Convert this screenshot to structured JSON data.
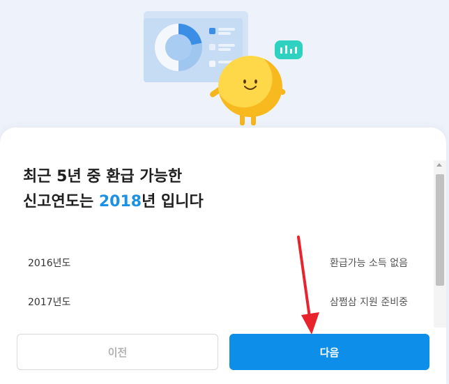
{
  "header": {
    "title_line1": "최근 5년 중 환급 가능한",
    "title_line2_prefix": "신고연도는 ",
    "title_line2_year": "2018",
    "title_line2_suffix": "년 입니다"
  },
  "years": [
    {
      "year": "2016년도",
      "status": "환급가능 소득 없음"
    },
    {
      "year": "2017년도",
      "status": "삼쩜삼 지원 준비중"
    }
  ],
  "buttons": {
    "prev_label": "이전",
    "next_label": "다음"
  },
  "colors": {
    "accent": "#0d8ee8",
    "highlight_year": "#1a91e6",
    "annotation_arrow": "#e8232b"
  }
}
